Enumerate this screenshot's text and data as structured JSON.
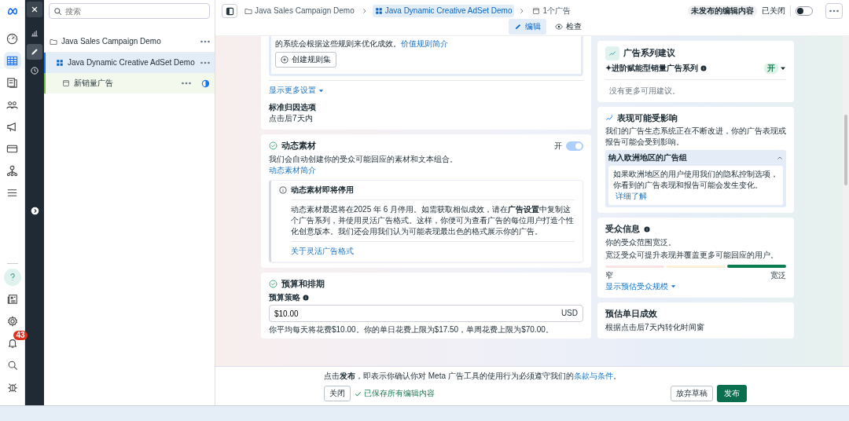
{
  "nav_rail": {
    "items": [
      {
        "selected": false
      },
      {
        "selected": true
      },
      {
        "selected": false
      },
      {
        "selected": false
      },
      {
        "selected": false
      },
      {
        "selected": false
      },
      {
        "selected": false
      },
      {
        "selected": false
      }
    ],
    "bottom_items": [
      {
        "selected": true
      },
      {
        "selected": false
      },
      {
        "selected": false
      },
      {
        "selected": false,
        "badge": "43"
      },
      {
        "selected": false
      },
      {
        "selected": false
      }
    ]
  },
  "tool_rail": {
    "items": [
      {
        "selected": false
      },
      {
        "selected": false
      },
      {
        "selected": true
      },
      {
        "selected": false
      }
    ]
  },
  "tree": {
    "search": {
      "placeholder": "搜索"
    },
    "items": [
      {
        "kind": "campaign",
        "label": "Java Sales Campaign Demo",
        "selected": false,
        "edited": false,
        "children": [
          {
            "kind": "adset",
            "label": "Java Dynamic Creative AdSet Demo",
            "selected": true,
            "edited": false,
            "children": [
              {
                "kind": "ad",
                "label": "新销量广告",
                "selected": false,
                "edited": true
              }
            ]
          }
        ]
      }
    ]
  },
  "header": {
    "breadcrumb": [
      {
        "kind": "campaign",
        "label": "Java Sales Campaign Demo",
        "selected": false
      },
      {
        "kind": "adset",
        "label": "Java Dynamic Creative AdSet Demo",
        "selected": true
      },
      {
        "kind": "ad",
        "label": "1个广告",
        "selected": false
      }
    ],
    "status_badge": "未发布的编辑内容",
    "toggle_label": "已关闭",
    "toggle_on": false,
    "mode_tabs": [
      {
        "kind": "edit",
        "label": "编辑",
        "selected": true
      },
      {
        "kind": "review",
        "label": "检查",
        "selected": false
      }
    ]
  },
  "main": {
    "rules_card": {
      "text": "的系统会根据这些规则来优化成效。",
      "link": "价值规则简介",
      "button": "创建规则集"
    },
    "more_settings_link": "显示更多设置",
    "attribution": {
      "label": "标准归因选项",
      "value": "点击后7天内"
    },
    "dynamic_creative": {
      "title": "动态素材",
      "complete": true,
      "toggle_label": "开",
      "toggle_on": true,
      "toggle_disabled": true,
      "description": "我们会自动创建你的受众可能回应的素材和文本组合。",
      "link": "动态素材简介",
      "notice": {
        "title": "动态素材即将停用",
        "body": "动态素材最迟将在2025 年 6 月停用。如需获取相似成效，请在**广告设置**中复制这个广告系列，并使用灵活广告格式。这样，你便可为查看广告的每位用户打造个性化创意版本。我们还会用我们认为可能表现最出色的格式展示你的广告。",
        "link": "关于灵活广告格式"
      }
    },
    "budget": {
      "title": "预算和排期",
      "complete": true,
      "label": "预算策略",
      "value": "$10.00",
      "currency": "USD",
      "note": "你平均每天将花费$10.00。你的单日花费上限为$17.50，单周花费上限为$70.00。"
    }
  },
  "sidebar": {
    "suggestions": {
      "title": "广告系列建议",
      "item": "✦进阶赋能型销量广告系列",
      "item_status": "开",
      "empty": "没有更多可用建议。"
    },
    "performance": {
      "title": "表现可能受影响",
      "text": "我们的广告生态系统正在不断改进，你的广告表现或报告可能会受到影响。",
      "accordion": {
        "title": "纳入欧洲地区的广告组",
        "expanded": true,
        "body": "如果欧洲地区的用户使用我们的隐私控制选项，你看到的广告表现和报告可能会发生变化。",
        "link": "详细了解"
      }
    },
    "audience": {
      "title": "受众信息",
      "text_1": "你的受众范围宽泛。",
      "text_2": "宽泛受众可提升表现并覆盖更多可能回应的用户。",
      "segments": [
        {
          "color": "#fbe3e4",
          "selected": false
        },
        {
          "color": "#fbefd8",
          "selected": false
        },
        {
          "color": "#0a7d4f",
          "selected": true
        }
      ],
      "min_label": "窄",
      "max_label": "宽泛",
      "link": "显示预估受众规模"
    },
    "estimate": {
      "title": "预估单日成效",
      "text": "根据点击后7天内转化时间窗"
    }
  },
  "footer": {
    "notice": "点击**发布**，即表示你确认你对 Meta 广告工具的使用行为必须遵守我们的",
    "notice_link": "条款与条件",
    "notice_end": "。",
    "close_button": "关闭",
    "saved_status": "已保存所有编辑内容",
    "discard_button": "放弃草稿",
    "publish_button": "发布"
  }
}
